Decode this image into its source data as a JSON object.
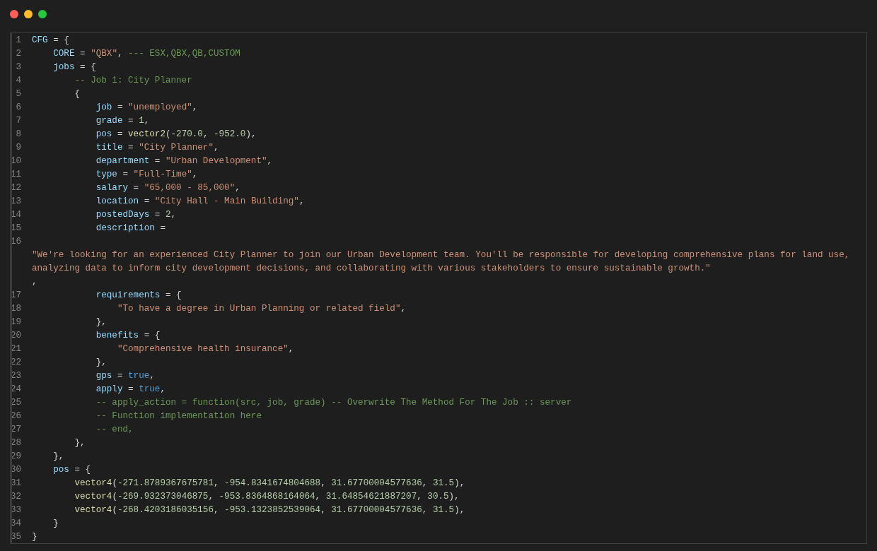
{
  "editor": {
    "lines": [
      {
        "number": "1",
        "tokens": [
          {
            "kind": "key",
            "text": "CFG"
          },
          {
            "kind": "plain",
            "text": " = {"
          }
        ]
      },
      {
        "number": "2",
        "tokens": [
          {
            "kind": "key",
            "text": "    CORE"
          },
          {
            "kind": "plain",
            "text": " = "
          },
          {
            "kind": "string",
            "text": "\"QBX\""
          },
          {
            "kind": "plain",
            "text": ", "
          },
          {
            "kind": "comment",
            "text": "--- ESX,QBX,QB,CUSTOM"
          }
        ]
      },
      {
        "number": "3",
        "tokens": [
          {
            "kind": "key",
            "text": "    jobs"
          },
          {
            "kind": "plain",
            "text": " = {"
          }
        ]
      },
      {
        "number": "4",
        "tokens": [
          {
            "kind": "comment",
            "text": "        -- Job 1: City Planner"
          }
        ]
      },
      {
        "number": "5",
        "tokens": [
          {
            "kind": "plain",
            "text": "        {"
          }
        ]
      },
      {
        "number": "6",
        "tokens": [
          {
            "kind": "key",
            "text": "            job"
          },
          {
            "kind": "plain",
            "text": " = "
          },
          {
            "kind": "string",
            "text": "\"unemployed\""
          },
          {
            "kind": "plain",
            "text": ","
          }
        ]
      },
      {
        "number": "7",
        "tokens": [
          {
            "kind": "key",
            "text": "            grade"
          },
          {
            "kind": "plain",
            "text": " = "
          },
          {
            "kind": "number",
            "text": "1"
          },
          {
            "kind": "plain",
            "text": ","
          }
        ]
      },
      {
        "number": "8",
        "tokens": [
          {
            "kind": "key",
            "text": "            pos"
          },
          {
            "kind": "plain",
            "text": " = "
          },
          {
            "kind": "function",
            "text": "vector2"
          },
          {
            "kind": "plain",
            "text": "("
          },
          {
            "kind": "number",
            "text": "-270.0"
          },
          {
            "kind": "plain",
            "text": ", "
          },
          {
            "kind": "number",
            "text": "-952.0"
          },
          {
            "kind": "plain",
            "text": "),"
          }
        ]
      },
      {
        "number": "9",
        "tokens": [
          {
            "kind": "key",
            "text": "            title"
          },
          {
            "kind": "plain",
            "text": " = "
          },
          {
            "kind": "string",
            "text": "\"City Planner\""
          },
          {
            "kind": "plain",
            "text": ","
          }
        ]
      },
      {
        "number": "10",
        "tokens": [
          {
            "kind": "key",
            "text": "            department"
          },
          {
            "kind": "plain",
            "text": " = "
          },
          {
            "kind": "string",
            "text": "\"Urban Development\""
          },
          {
            "kind": "plain",
            "text": ","
          }
        ]
      },
      {
        "number": "11",
        "tokens": [
          {
            "kind": "key",
            "text": "            type"
          },
          {
            "kind": "plain",
            "text": " = "
          },
          {
            "kind": "string",
            "text": "\"Full-Time\""
          },
          {
            "kind": "plain",
            "text": ","
          }
        ]
      },
      {
        "number": "12",
        "tokens": [
          {
            "kind": "key",
            "text": "            salary"
          },
          {
            "kind": "plain",
            "text": " = "
          },
          {
            "kind": "string",
            "text": "\"65,000 - 85,000\""
          },
          {
            "kind": "plain",
            "text": ","
          }
        ]
      },
      {
        "number": "13",
        "tokens": [
          {
            "kind": "key",
            "text": "            location"
          },
          {
            "kind": "plain",
            "text": " = "
          },
          {
            "kind": "string",
            "text": "\"City Hall - Main Building\""
          },
          {
            "kind": "plain",
            "text": ","
          }
        ]
      },
      {
        "number": "14",
        "tokens": [
          {
            "kind": "key",
            "text": "            postedDays"
          },
          {
            "kind": "plain",
            "text": " = "
          },
          {
            "kind": "number",
            "text": "2"
          },
          {
            "kind": "plain",
            "text": ","
          }
        ]
      },
      {
        "number": "15",
        "tokens": [
          {
            "kind": "key",
            "text": "            description"
          },
          {
            "kind": "plain",
            "text": " ="
          }
        ]
      },
      {
        "number": "16"
      },
      {
        "tokens": [
          {
            "kind": "string",
            "text": "\"We're looking for an experienced City Planner to join our Urban Development team. You'll be responsible for developing comprehensive plans for land use,"
          }
        ]
      },
      {
        "tokens": [
          {
            "kind": "string",
            "text": "analyzing data to inform city development decisions, and collaborating with various stakeholders to ensure sustainable growth.\""
          }
        ]
      },
      {
        "tokens": [
          {
            "kind": "plain",
            "text": ","
          }
        ]
      },
      {
        "number": "17",
        "tokens": [
          {
            "kind": "key",
            "text": "            requirements"
          },
          {
            "kind": "plain",
            "text": " = {"
          }
        ]
      },
      {
        "number": "18",
        "tokens": [
          {
            "kind": "string",
            "text": "                \"To have a degree in Urban Planning or related field\""
          },
          {
            "kind": "plain",
            "text": ","
          }
        ]
      },
      {
        "number": "19",
        "tokens": [
          {
            "kind": "plain",
            "text": "            },"
          }
        ]
      },
      {
        "number": "20",
        "tokens": [
          {
            "kind": "key",
            "text": "            benefits"
          },
          {
            "kind": "plain",
            "text": " = {"
          }
        ]
      },
      {
        "number": "21",
        "tokens": [
          {
            "kind": "string",
            "text": "                \"Comprehensive health insurance\""
          },
          {
            "kind": "plain",
            "text": ","
          }
        ]
      },
      {
        "number": "22",
        "tokens": [
          {
            "kind": "plain",
            "text": "            },"
          }
        ]
      },
      {
        "number": "23",
        "tokens": [
          {
            "kind": "key",
            "text": "            gps"
          },
          {
            "kind": "plain",
            "text": " = "
          },
          {
            "kind": "keyword",
            "text": "true"
          },
          {
            "kind": "plain",
            "text": ","
          }
        ]
      },
      {
        "number": "24",
        "tokens": [
          {
            "kind": "key",
            "text": "            apply"
          },
          {
            "kind": "plain",
            "text": " = "
          },
          {
            "kind": "keyword",
            "text": "true"
          },
          {
            "kind": "plain",
            "text": ","
          }
        ]
      },
      {
        "number": "25",
        "tokens": [
          {
            "kind": "comment",
            "text": "            -- apply_action = function(src, job, grade) -- Overwrite The Method For The Job :: server"
          }
        ]
      },
      {
        "number": "26",
        "tokens": [
          {
            "kind": "comment",
            "text": "            -- Function implementation here"
          }
        ]
      },
      {
        "number": "27",
        "tokens": [
          {
            "kind": "comment",
            "text": "            -- end,"
          }
        ]
      },
      {
        "number": "28",
        "tokens": [
          {
            "kind": "plain",
            "text": "        },"
          }
        ]
      },
      {
        "number": "29",
        "tokens": [
          {
            "kind": "plain",
            "text": "    },"
          }
        ]
      },
      {
        "number": "30",
        "tokens": [
          {
            "kind": "key",
            "text": "    pos"
          },
          {
            "kind": "plain",
            "text": " = {"
          }
        ]
      },
      {
        "number": "31",
        "tokens": [
          {
            "kind": "function",
            "text": "        vector4"
          },
          {
            "kind": "plain",
            "text": "("
          },
          {
            "kind": "number",
            "text": "-271.8789367675781"
          },
          {
            "kind": "plain",
            "text": ", "
          },
          {
            "kind": "number",
            "text": "-954.8341674804688"
          },
          {
            "kind": "plain",
            "text": ", "
          },
          {
            "kind": "number",
            "text": "31.67700004577636"
          },
          {
            "kind": "plain",
            "text": ", "
          },
          {
            "kind": "number",
            "text": "31.5"
          },
          {
            "kind": "plain",
            "text": "),"
          }
        ]
      },
      {
        "number": "32",
        "tokens": [
          {
            "kind": "function",
            "text": "        vector4"
          },
          {
            "kind": "plain",
            "text": "("
          },
          {
            "kind": "number",
            "text": "-269.932373046875"
          },
          {
            "kind": "plain",
            "text": ", "
          },
          {
            "kind": "number",
            "text": "-953.8364868164064"
          },
          {
            "kind": "plain",
            "text": ", "
          },
          {
            "kind": "number",
            "text": "31.64854621887207"
          },
          {
            "kind": "plain",
            "text": ", "
          },
          {
            "kind": "number",
            "text": "30.5"
          },
          {
            "kind": "plain",
            "text": "),"
          }
        ]
      },
      {
        "number": "33",
        "tokens": [
          {
            "kind": "function",
            "text": "        vector4"
          },
          {
            "kind": "plain",
            "text": "("
          },
          {
            "kind": "number",
            "text": "-268.4203186035156"
          },
          {
            "kind": "plain",
            "text": ", "
          },
          {
            "kind": "number",
            "text": "-953.1323852539064"
          },
          {
            "kind": "plain",
            "text": ", "
          },
          {
            "kind": "number",
            "text": "31.67700004577636"
          },
          {
            "kind": "plain",
            "text": ", "
          },
          {
            "kind": "number",
            "text": "31.5"
          },
          {
            "kind": "plain",
            "text": "),"
          }
        ]
      },
      {
        "number": "34",
        "tokens": [
          {
            "kind": "plain",
            "text": "    }"
          }
        ]
      },
      {
        "number": "35",
        "tokens": [
          {
            "kind": "plain",
            "text": "}"
          }
        ]
      }
    ]
  }
}
